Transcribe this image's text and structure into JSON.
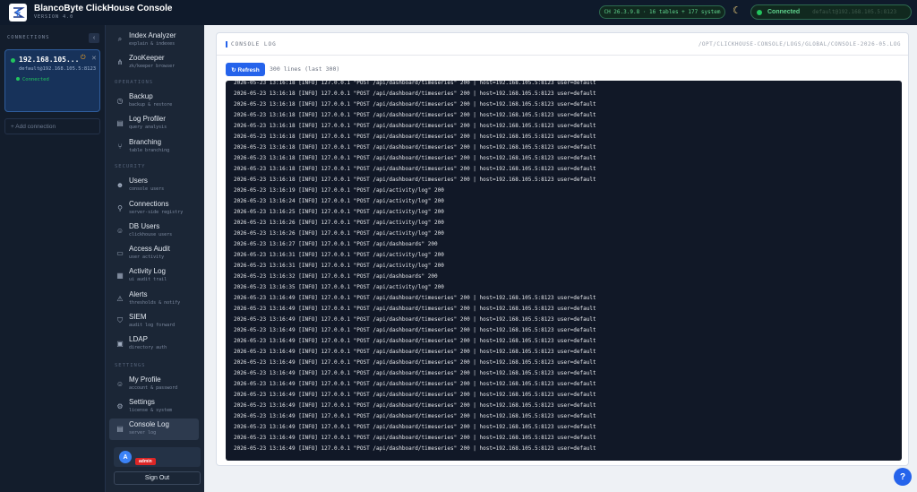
{
  "app": {
    "title": "BlancoByte ClickHouse Console",
    "version": "VERSION 4.0"
  },
  "topbar": {
    "server_info": "CH 26.3.9.8 · 16 tables + 177 system",
    "theme_icon": "moon-icon",
    "connection_status": "Connected",
    "connection_detail": "default@192.168.105.5:8123"
  },
  "connections": {
    "header": "CONNECTIONS",
    "collapse_label": "‹",
    "items": [
      {
        "host": "192.168.105...",
        "user": "default@192.168.105.5:8123",
        "status": "Connected"
      }
    ],
    "add_label": "+ Add connection"
  },
  "nav": {
    "items": [
      {
        "label": "Index Analyzer",
        "sub": "explain & indexes",
        "icon": "magnifier-icon"
      },
      {
        "label": "ZooKeeper",
        "sub": "zk/keeper browser",
        "icon": "tree-icon"
      }
    ],
    "operations_label": "OPERATIONS",
    "operations": [
      {
        "label": "Backup",
        "sub": "backup & restore",
        "icon": "backup-icon"
      },
      {
        "label": "Log Profiler",
        "sub": "query analysis",
        "icon": "document-icon"
      },
      {
        "label": "Branching",
        "sub": "table branching",
        "icon": "branch-icon"
      }
    ],
    "security_label": "SECURITY",
    "security": [
      {
        "label": "Users",
        "sub": "console users",
        "icon": "users-icon"
      },
      {
        "label": "Connections",
        "sub": "server-side registry",
        "icon": "plug-icon"
      },
      {
        "label": "DB Users",
        "sub": "clickhouse users",
        "icon": "db-users-icon"
      },
      {
        "label": "Access Audit",
        "sub": "user activity",
        "icon": "audit-icon"
      },
      {
        "label": "Activity Log",
        "sub": "ui audit trail",
        "icon": "activity-icon"
      },
      {
        "label": "Alerts",
        "sub": "thresholds & notify",
        "icon": "bell-icon"
      },
      {
        "label": "SIEM",
        "sub": "audit log forward",
        "icon": "shield-icon"
      },
      {
        "label": "LDAP",
        "sub": "directory auth",
        "icon": "directory-icon"
      }
    ],
    "settings_label": "SETTINGS",
    "settings": [
      {
        "label": "My Profile",
        "sub": "account & password",
        "icon": "profile-icon"
      },
      {
        "label": "Settings",
        "sub": "license & system",
        "icon": "gear-icon"
      },
      {
        "label": "Console Log",
        "sub": "server log",
        "icon": "log-icon"
      }
    ],
    "user_initial": "A",
    "user_role": "admin",
    "sign_out": "Sign Out"
  },
  "main": {
    "title": "CONSOLE LOG",
    "path": "/OPT/CLICKHOUSE-CONSOLE/LOGS/GLOBAL/CONSOLE-2026-05.LOG",
    "refresh_label": "↻ Refresh",
    "lines_count": "300 lines (last 300)",
    "log_lines": [
      "2026-05-23 13:16:18 [INFO] 127.0.0.1 \"POST /api/dashboard/timeseries\" 200 | host=192.168.105.5:8123 user=default",
      "2026-05-23 13:16:18 [INFO] 127.0.0.1 \"POST /api/dashboard/timeseries\" 200 | host=192.168.105.5:8123 user=default",
      "2026-05-23 13:16:18 [INFO] 127.0.0.1 \"POST /api/dashboard/timeseries\" 200 | host=192.168.105.5:8123 user=default",
      "2026-05-23 13:16:18 [INFO] 127.0.0.1 \"POST /api/dashboard/timeseries\" 200 | host=192.168.105.5:8123 user=default",
      "2026-05-23 13:16:18 [INFO] 127.0.0.1 \"POST /api/dashboard/timeseries\" 200 | host=192.168.105.5:8123 user=default",
      "2026-05-23 13:16:18 [INFO] 127.0.0.1 \"POST /api/dashboard/timeseries\" 200 | host=192.168.105.5:8123 user=default",
      "2026-05-23 13:16:18 [INFO] 127.0.0.1 \"POST /api/dashboard/timeseries\" 200 | host=192.168.105.5:8123 user=default",
      "2026-05-23 13:16:18 [INFO] 127.0.0.1 \"POST /api/dashboard/timeseries\" 200 | host=192.168.105.5:8123 user=default",
      "2026-05-23 13:16:18 [INFO] 127.0.0.1 \"POST /api/dashboard/timeseries\" 200 | host=192.168.105.5:8123 user=default",
      "2026-05-23 13:16:18 [INFO] 127.0.0.1 \"POST /api/dashboard/timeseries\" 200 | host=192.168.105.5:8123 user=default",
      "2026-05-23 13:16:19 [INFO] 127.0.0.1 \"POST /api/activity/log\" 200",
      "2026-05-23 13:16:24 [INFO] 127.0.0.1 \"POST /api/activity/log\" 200",
      "2026-05-23 13:16:25 [INFO] 127.0.0.1 \"POST /api/activity/log\" 200",
      "2026-05-23 13:16:26 [INFO] 127.0.0.1 \"POST /api/activity/log\" 200",
      "2026-05-23 13:16:26 [INFO] 127.0.0.1 \"POST /api/activity/log\" 200",
      "2026-05-23 13:16:27 [INFO] 127.0.0.1 \"POST /api/dashboards\" 200",
      "2026-05-23 13:16:31 [INFO] 127.0.0.1 \"POST /api/activity/log\" 200",
      "2026-05-23 13:16:31 [INFO] 127.0.0.1 \"POST /api/activity/log\" 200",
      "2026-05-23 13:16:32 [INFO] 127.0.0.1 \"POST /api/dashboards\" 200",
      "2026-05-23 13:16:35 [INFO] 127.0.0.1 \"POST /api/activity/log\" 200",
      "2026-05-23 13:16:49 [INFO] 127.0.0.1 \"POST /api/dashboard/timeseries\" 200 | host=192.168.105.5:8123 user=default",
      "2026-05-23 13:16:49 [INFO] 127.0.0.1 \"POST /api/dashboard/timeseries\" 200 | host=192.168.105.5:8123 user=default",
      "2026-05-23 13:16:49 [INFO] 127.0.0.1 \"POST /api/dashboard/timeseries\" 200 | host=192.168.105.5:8123 user=default",
      "2026-05-23 13:16:49 [INFO] 127.0.0.1 \"POST /api/dashboard/timeseries\" 200 | host=192.168.105.5:8123 user=default",
      "2026-05-23 13:16:49 [INFO] 127.0.0.1 \"POST /api/dashboard/timeseries\" 200 | host=192.168.105.5:8123 user=default",
      "2026-05-23 13:16:49 [INFO] 127.0.0.1 \"POST /api/dashboard/timeseries\" 200 | host=192.168.105.5:8123 user=default",
      "2026-05-23 13:16:49 [INFO] 127.0.0.1 \"POST /api/dashboard/timeseries\" 200 | host=192.168.105.5:8123 user=default",
      "2026-05-23 13:16:49 [INFO] 127.0.0.1 \"POST /api/dashboard/timeseries\" 200 | host=192.168.105.5:8123 user=default",
      "2026-05-23 13:16:49 [INFO] 127.0.0.1 \"POST /api/dashboard/timeseries\" 200 | host=192.168.105.5:8123 user=default",
      "2026-05-23 13:16:49 [INFO] 127.0.0.1 \"POST /api/dashboard/timeseries\" 200 | host=192.168.105.5:8123 user=default",
      "2026-05-23 13:16:49 [INFO] 127.0.0.1 \"POST /api/dashboard/timeseries\" 200 | host=192.168.105.5:8123 user=default",
      "2026-05-23 13:16:49 [INFO] 127.0.0.1 \"POST /api/dashboard/timeseries\" 200 | host=192.168.105.5:8123 user=default",
      "2026-05-23 13:16:49 [INFO] 127.0.0.1 \"POST /api/dashboard/timeseries\" 200 | host=192.168.105.5:8123 user=default",
      "2026-05-23 13:16:49 [INFO] 127.0.0.1 \"POST /api/dashboard/timeseries\" 200 | host=192.168.105.5:8123 user=default",
      "2026-05-23 13:16:49 [INFO] 127.0.0.1 \"POST /api/dashboard/timeseries\" 200 | host=192.168.105.5:8123 user=default"
    ]
  },
  "help_label": "?",
  "colors": {
    "accent": "#2563eb",
    "success": "#22c55e",
    "danger": "#dc2626",
    "topbar_bg": "#0f1a2b",
    "sidebar_bg": "#1b2636",
    "log_bg": "#111827"
  }
}
